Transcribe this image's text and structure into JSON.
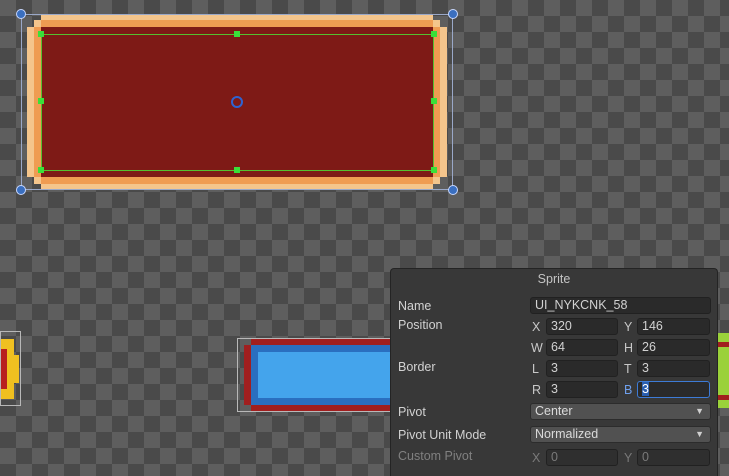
{
  "panel": {
    "title": "Sprite",
    "name": {
      "label": "Name",
      "value": "UI_NYKCNK_58"
    },
    "position": {
      "label": "Position",
      "x": {
        "axis": "X",
        "value": "320"
      },
      "y": {
        "axis": "Y",
        "value": "146"
      },
      "w": {
        "axis": "W",
        "value": "64"
      },
      "h": {
        "axis": "H",
        "value": "26"
      }
    },
    "border": {
      "label": "Border",
      "l": {
        "axis": "L",
        "value": "3"
      },
      "t": {
        "axis": "T",
        "value": "3"
      },
      "r": {
        "axis": "R",
        "value": "3"
      },
      "b": {
        "axis": "B",
        "value": "3"
      }
    },
    "pivot": {
      "label": "Pivot",
      "value": "Center"
    },
    "pivot_unit_mode": {
      "label": "Pivot Unit Mode",
      "value": "Normalized"
    },
    "custom_pivot": {
      "label": "Custom Pivot",
      "x": {
        "axis": "X",
        "value": "0"
      },
      "y": {
        "axis": "Y",
        "value": "0"
      }
    }
  },
  "icons": {
    "corner_handle": "circle-handle-icon",
    "edge_handle": "square-handle-icon",
    "pivot": "pivot-circle-icon",
    "dropdown": "chevron-down-icon"
  },
  "colors": {
    "sprite_fill": "#7e1a16",
    "sprite_border_light": "#f4c58c",
    "sprite_border_mid": "#ef9c52",
    "blue_fill": "#44a4ec",
    "guide_green": "#39e039",
    "handle_blue": "#3a6fc0"
  }
}
